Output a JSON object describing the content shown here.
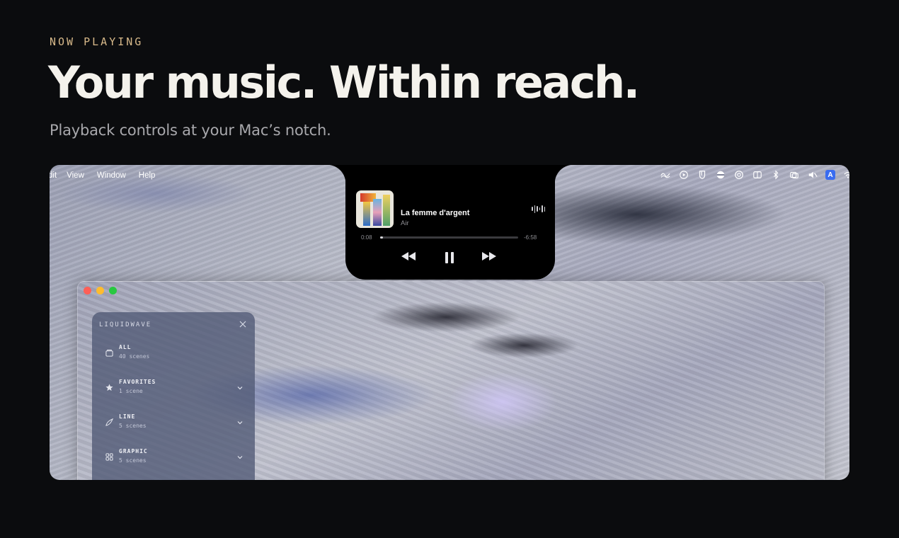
{
  "hero": {
    "eyebrow": "NOW PLAYING",
    "headline": "Your music. Within reach.",
    "subline": "Playback controls at your Mac’s notch."
  },
  "menubar": {
    "items": [
      "dit",
      "View",
      "Window",
      "Help"
    ],
    "status_icons": [
      "waveform-icon",
      "play-circle-icon",
      "shield-icon",
      "half-circle-icon",
      "power-circle-icon",
      "split-window-icon",
      "bluetooth-icon",
      "window-stack-icon",
      "mute-icon",
      "input-source-icon",
      "wifi-icon"
    ],
    "input_source_label": "A"
  },
  "player": {
    "title": "La femme d'argent",
    "artist": "Air",
    "elapsed": "0:08",
    "remaining": "-6:58",
    "progress": 0.02
  },
  "panel": {
    "title": "LIQUIDWAVE",
    "categories": [
      {
        "name": "ALL",
        "count": "40 scenes",
        "icon": "folder-icon"
      },
      {
        "name": "FAVORITES",
        "count": "1 scene",
        "icon": "star-icon"
      },
      {
        "name": "LINE",
        "count": "5 scenes",
        "icon": "brush-icon"
      },
      {
        "name": "GRAPHIC",
        "count": "5 scenes",
        "icon": "grid-icon"
      }
    ]
  },
  "colors": {
    "accent": "#d7b98a",
    "background": "#0b0c0e",
    "close": "#fe5f57",
    "minimize": "#febc2e",
    "maximize": "#28c840"
  }
}
